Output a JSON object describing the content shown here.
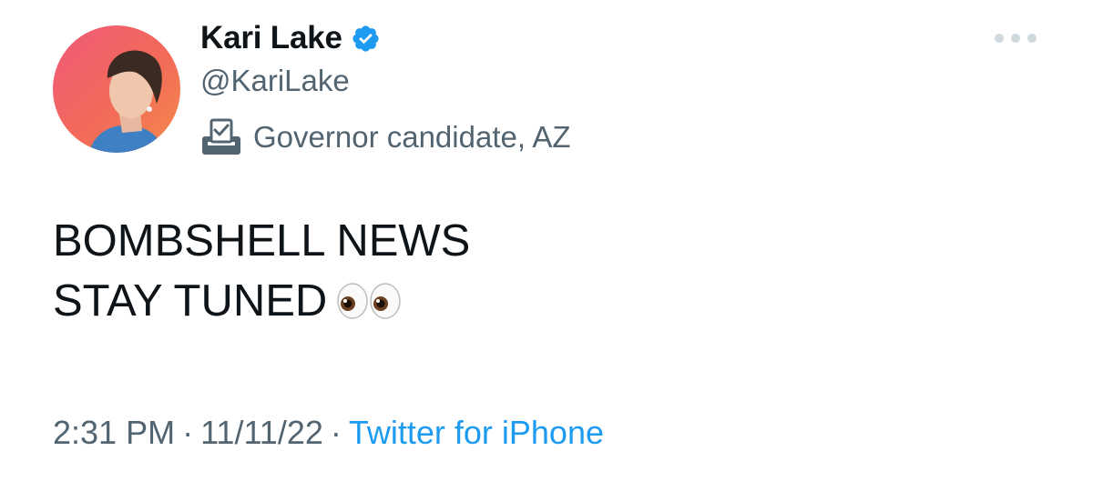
{
  "author": {
    "display_name": "Kari Lake",
    "handle": "@KariLake",
    "verified": true,
    "label_icon": "ballot-box-icon",
    "label": "Governor candidate, AZ",
    "avatar": "profile-photo"
  },
  "tweet": {
    "lines": [
      "BOMBSHELL NEWS",
      "STAY TUNED"
    ],
    "emoji": "eyes-emoji"
  },
  "meta": {
    "time": "2:31 PM",
    "separator": "·",
    "date": "11/11/22",
    "source": "Twitter for iPhone"
  },
  "colors": {
    "text_primary": "#0f1419",
    "text_secondary": "#536471",
    "accent": "#1d9bf0",
    "more_dots": "#cfd9de"
  }
}
